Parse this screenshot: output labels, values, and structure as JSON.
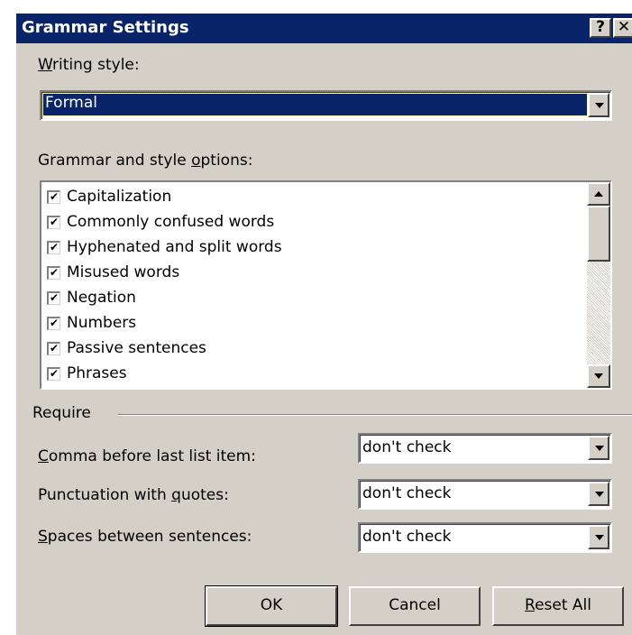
{
  "window": {
    "title": "Grammar Settings",
    "help_label": "?",
    "close_label": "✕"
  },
  "writing_style": {
    "label_mnemonic": "W",
    "label_rest": "riting style:",
    "value": "Formal"
  },
  "options": {
    "label_before": "Grammar and style ",
    "label_mnemonic": "o",
    "label_after": "ptions:",
    "check_mark": "✔",
    "items": [
      {
        "label": "Capitalization",
        "checked": true
      },
      {
        "label": "Commonly confused words",
        "checked": true
      },
      {
        "label": "Hyphenated and split words",
        "checked": true
      },
      {
        "label": "Misused words",
        "checked": true
      },
      {
        "label": "Negation",
        "checked": true
      },
      {
        "label": "Numbers",
        "checked": true
      },
      {
        "label": "Passive sentences",
        "checked": true
      },
      {
        "label": "Phrases",
        "checked": true
      }
    ]
  },
  "require": {
    "group_label": "Require",
    "comma": {
      "label_mnemonic": "C",
      "label_rest": "omma before last list item:",
      "value": "don't check"
    },
    "punctuation": {
      "label_before": "Punctuation with ",
      "label_mnemonic": "q",
      "label_after": "uotes:",
      "value": "don't check"
    },
    "spaces": {
      "label_mnemonic": "S",
      "label_rest": "paces between sentences:",
      "value": "don't check"
    }
  },
  "buttons": {
    "ok": "OK",
    "cancel": "Cancel",
    "reset_mnemonic": "R",
    "reset_rest": "eset All"
  }
}
